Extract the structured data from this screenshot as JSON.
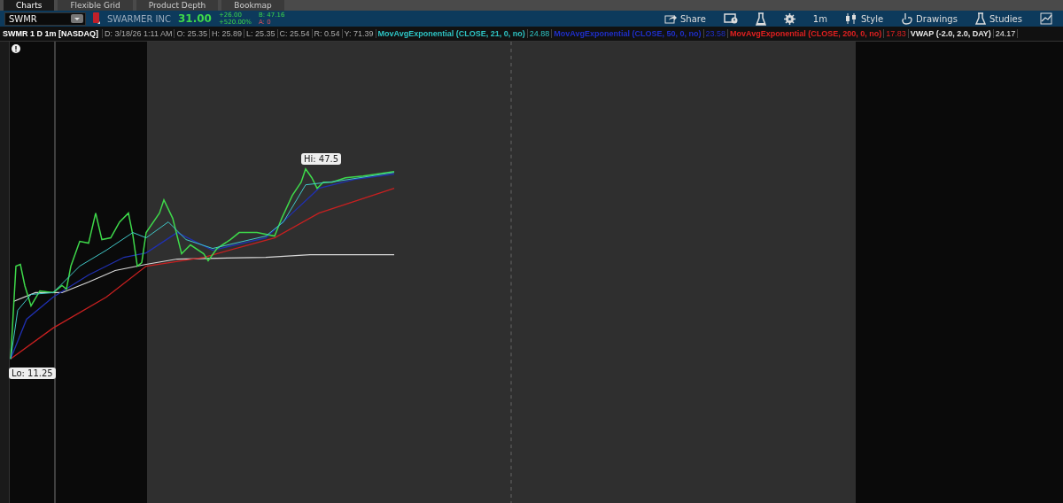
{
  "tabs": [
    {
      "label": "Charts",
      "selected": true
    },
    {
      "label": "Flexible Grid",
      "selected": false
    },
    {
      "label": "Product Depth",
      "selected": false
    },
    {
      "label": "Bookmap",
      "selected": false
    }
  ],
  "toolbar": {
    "symbol": "SWMR",
    "company": "SWARMER INC",
    "last": "31.00",
    "change": "+26.00",
    "change_pct": "+520.00%",
    "bid": "B: 47.16",
    "ask": "A: 0",
    "buttons": [
      {
        "kind": "share",
        "label": "Share"
      },
      {
        "kind": "alert"
      },
      {
        "kind": "flask"
      },
      {
        "kind": "gear"
      },
      {
        "kind": "text",
        "label": "1m"
      },
      {
        "kind": "style",
        "label": "Style"
      },
      {
        "kind": "drawings",
        "label": "Drawings"
      },
      {
        "kind": "studies",
        "label": "Studies"
      },
      {
        "kind": "chart"
      }
    ]
  },
  "header": {
    "symbol_label": "SWMR 1 D 1m [NASDAQ]",
    "stats": [
      "D: 3/18/26 1:11 AM",
      "O: 25.35",
      "H: 25.89",
      "L: 25.35",
      "C: 25.54",
      "R: 0.54",
      "Y: 71.39"
    ],
    "studies": [
      {
        "label": "MovAvgExponential (CLOSE, 21, 0, no)",
        "value": "24.88",
        "color": "#2ec4c4"
      },
      {
        "label": "MovAvgExponential (CLOSE, 50, 0, no)",
        "value": "23.58",
        "color": "#1f2fc8"
      },
      {
        "label": "MovAvgExponential (CLOSE, 200, 0, no)",
        "value": "17.83",
        "color": "#e02020"
      },
      {
        "label": "VWAP (-2.0, 2.0, DAY)",
        "value": "24.17",
        "color": "#e8e8e8"
      }
    ]
  },
  "chart": {
    "hi_label": "Hi: 47.5",
    "lo_label": "Lo: 11.25"
  }
}
